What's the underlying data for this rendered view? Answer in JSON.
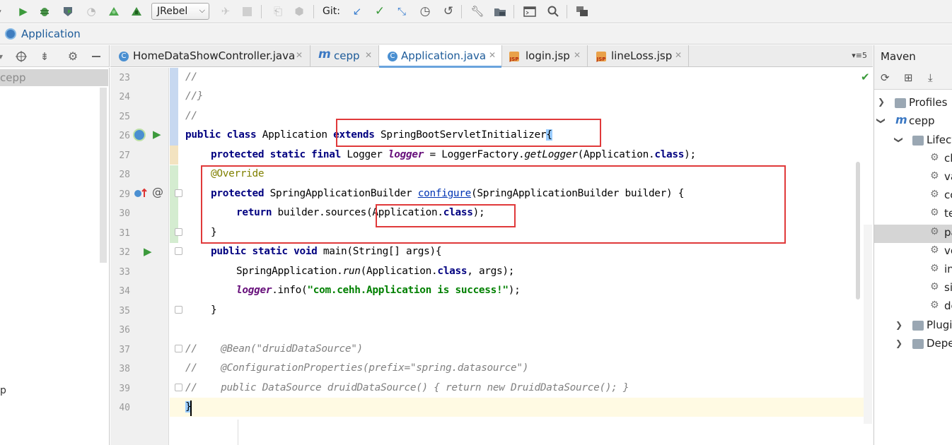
{
  "toolbar": {
    "run_config": "JRebel",
    "git_label": "Git:",
    "icons": [
      "run-icon",
      "debug-icon",
      "coverage-icon",
      "profile-icon",
      "jrebel-run-icon",
      "jrebel-debug-icon",
      "build-icon",
      "stop-icon",
      "attach-icon",
      "package-icon",
      "git-update-icon",
      "git-commit-icon",
      "git-compare-icon",
      "git-history-icon",
      "git-revert-icon",
      "settings-wrench-icon",
      "project-structure-icon",
      "terminal-icon",
      "search-icon",
      "vcs-icon"
    ]
  },
  "navbar": {
    "title": "Application"
  },
  "project_panel": {
    "selected": "cepp",
    "partial_label": "p"
  },
  "tabs": [
    {
      "label": "HomeDataShowController.java",
      "type": "class"
    },
    {
      "label": "cepp",
      "type": "maven"
    },
    {
      "label": "Application.java",
      "type": "class",
      "active": true
    },
    {
      "label": "login.jsp",
      "type": "jsp"
    },
    {
      "label": "lineLoss.jsp",
      "type": "jsp"
    }
  ],
  "tab_overflow": "5",
  "code": {
    "line_numbers": [
      "23",
      "24",
      "25",
      "26",
      "27",
      "28",
      "29",
      "30",
      "31",
      "32",
      "33",
      "34",
      "35",
      "36",
      "37",
      "38",
      "39",
      "40"
    ],
    "l23": "//",
    "l24": "//}",
    "l25": "//",
    "l26": {
      "kw1": "public class",
      "name": " Application ",
      "kw2": "extends",
      "rest": " SpringBootServletInitializer",
      "brace": "{"
    },
    "l27": {
      "kw": "protected static final",
      "type": " Logger ",
      "field": "logger",
      "eq": " = LoggerFactory.",
      "method": "getLogger",
      "args": "(Application.",
      "kw2": "class",
      "end": ");"
    },
    "l28": "@Override",
    "l29": {
      "kw": "protected",
      "type": " SpringApplicationBuilder ",
      "method": "configure",
      "args": "(SpringApplicationBuilder builder) {"
    },
    "l30": {
      "kw": "return",
      "rest": " builder.sources",
      "args": "(Application.",
      "kw2": "class",
      "end": ");"
    },
    "l31": "}",
    "l32": {
      "kw": "public static void",
      "rest": " main(String[] args){"
    },
    "l33": {
      "pre": "SpringApplication.",
      "method": "run",
      "args": "(Application.",
      "kw2": "class",
      "end": ", args);"
    },
    "l34": {
      "field": "logger",
      "mid": ".info(",
      "str": "\"com.cehh.Application is success!\"",
      "end": ");"
    },
    "l35": "}",
    "l36": "",
    "l37": "//    @Bean(\"druidDataSource\")",
    "l38": "//    @ConfigurationProperties(prefix=\"spring.datasource\")",
    "l39": "//    public DataSource druidDataSource() { return new DruidDataSource(); }",
    "l40": "}"
  },
  "maven": {
    "title": "Maven",
    "tree": [
      {
        "label": "Profiles",
        "level": 0
      },
      {
        "label": "cepp",
        "level": 0
      },
      {
        "label": "Lifecy",
        "level": 1
      },
      {
        "label": "cl",
        "level": 2
      },
      {
        "label": "va",
        "level": 2
      },
      {
        "label": "cc",
        "level": 2
      },
      {
        "label": "te",
        "level": 2
      },
      {
        "label": "pa",
        "level": 2
      },
      {
        "label": "ve",
        "level": 2
      },
      {
        "label": "in",
        "level": 2
      },
      {
        "label": "si",
        "level": 2
      },
      {
        "label": "de",
        "level": 2
      },
      {
        "label": "Plugi",
        "level": 1
      },
      {
        "label": "Depe",
        "level": 1
      }
    ]
  },
  "colors": {
    "highlight_box": "#e0393a",
    "keyword": "#000080",
    "string": "#008000",
    "annotation": "#808000",
    "accent": "#6aa4dd"
  }
}
